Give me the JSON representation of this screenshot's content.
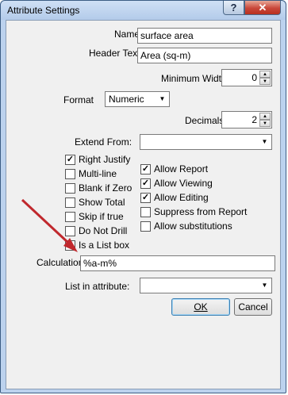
{
  "window": {
    "title": "Attribute Settings",
    "help_label": "?",
    "close_label": "✕"
  },
  "form": {
    "name_label": "Name",
    "name_value": "surface area",
    "header_text_label": "Header Text",
    "header_text_value": "Area (sq-m)",
    "min_width_label": "Minimum Width",
    "min_width_value": "0",
    "format_label": "Format",
    "format_value": "Numeric",
    "decimals_label": "Decimals",
    "decimals_value": "2",
    "extend_from_label": "Extend From:",
    "extend_from_value": "",
    "calculation_label": "Calculation",
    "calculation_value": "%a-m%",
    "list_in_attr_label": "List in attribute:",
    "list_in_attr_value": ""
  },
  "left_checks": [
    {
      "label": "Right Justify",
      "checked": true
    },
    {
      "label": "Multi-line",
      "checked": false
    },
    {
      "label": "Blank if Zero",
      "checked": false
    },
    {
      "label": "Show Total",
      "checked": false
    },
    {
      "label": "Skip if true",
      "checked": false
    },
    {
      "label": "Do Not Drill",
      "checked": false
    },
    {
      "label": "Is a List box",
      "checked": false
    }
  ],
  "right_checks": [
    {
      "label": "Allow Report",
      "checked": true
    },
    {
      "label": "Allow Viewing",
      "checked": true
    },
    {
      "label": "Allow Editing",
      "checked": true
    },
    {
      "label": "Suppress from Report",
      "checked": false
    },
    {
      "label": "Allow substitutions",
      "checked": false
    }
  ],
  "buttons": {
    "ok_label": "OK",
    "cancel_label": "Cancel"
  },
  "annotation": {
    "arrow_color": "#c0282d"
  }
}
